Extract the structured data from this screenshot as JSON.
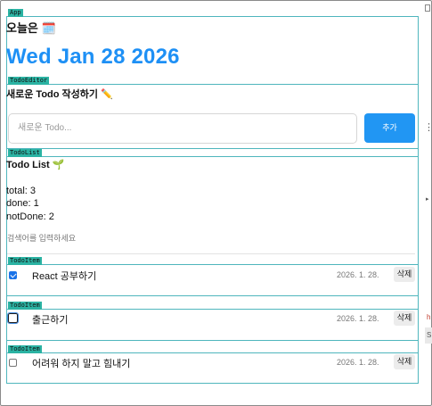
{
  "app": {
    "tag": "App"
  },
  "header": {
    "title": "오늘은 🗓️",
    "date": "Wed Jan 28 2026"
  },
  "editor": {
    "tag": "TodoEditor",
    "title": "새로운 Todo 작성하기 ✏️",
    "placeholder": "새로운 Todo...",
    "add_label": "추가"
  },
  "list": {
    "tag": "TodoList",
    "title": "Todo List 🌱",
    "stats": {
      "total": "total: 3",
      "done": "done: 1",
      "notDone": "notDone: 2"
    },
    "search_placeholder": "검색어를 입력하세요"
  },
  "items": [
    {
      "tag": "TodoItem",
      "done": true,
      "content": "React 공부하기",
      "date": "2026. 1. 28.",
      "delete_label": "삭제"
    },
    {
      "tag": "TodoItem",
      "done": false,
      "content": "출근하기",
      "date": "2026. 1. 28.",
      "delete_label": "삭제"
    },
    {
      "tag": "TodoItem",
      "done": false,
      "content": "어려워 하지 말고 힘내기",
      "date": "2026. 1. 28.",
      "delete_label": "삭제"
    }
  ],
  "side": {
    "dots": "⋮",
    "arrow": "▸",
    "h": "h",
    "s": "S"
  }
}
